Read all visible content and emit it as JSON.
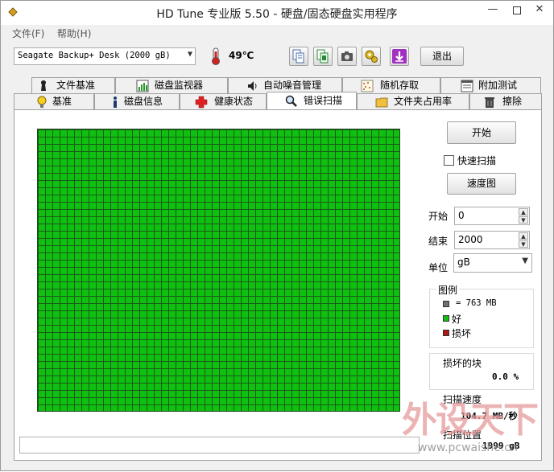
{
  "window": {
    "title": "HD Tune 专业版 5.50 - 硬盘/固态硬盘实用程序",
    "min": "—",
    "close": "✕"
  },
  "menu": {
    "file": "文件(F)",
    "help": "帮助(H)"
  },
  "toolbar": {
    "drive": "Seagate Backup+ Desk (2000 gB)",
    "temperature": "49℃",
    "exit": "退出",
    "icons": [
      "copy-text-icon",
      "copy-info-icon",
      "screenshot-camera-icon",
      "options-gear-icon",
      "save-download-icon"
    ]
  },
  "tabs": {
    "row1": [
      {
        "label": "文件基准",
        "icon": "file-benchmark-icon"
      },
      {
        "label": "磁盘监视器",
        "icon": "disk-monitor-icon"
      },
      {
        "label": "自动噪音管理",
        "icon": "speaker-icon"
      },
      {
        "label": "随机存取",
        "icon": "random-access-icon"
      },
      {
        "label": "附加测试",
        "icon": "extra-tests-icon"
      }
    ],
    "row2": [
      {
        "label": "基准",
        "icon": "benchmark-bulb-icon"
      },
      {
        "label": "磁盘信息",
        "icon": "info-icon"
      },
      {
        "label": "健康状态",
        "icon": "health-cross-icon"
      },
      {
        "label": "错误扫描",
        "icon": "magnifier-icon"
      },
      {
        "label": "文件夹占用率",
        "icon": "folder-icon"
      },
      {
        "label": "擦除",
        "icon": "trash-icon"
      }
    ],
    "active": "错误扫描"
  },
  "scan": {
    "start_button": "开始",
    "quick_scan": "快速扫描",
    "speed_map": "速度图",
    "start_label": "开始",
    "start_value": "0",
    "end_label": "结束",
    "end_value": "2000",
    "unit_label": "单位",
    "unit_value": "gB",
    "block_status": "good",
    "legend": {
      "title": "图例",
      "block_size": "= 763 MB",
      "good": "好",
      "bad": "损坏"
    },
    "colors": {
      "good": "#10c010",
      "bad": "#b01818",
      "block": "#707070",
      "grid": "#1a5a1a"
    },
    "stats": {
      "damaged_label": "损坏的块",
      "damaged_value": "0.0 %",
      "speed_label": "扫描速度",
      "speed_value": "104.7 MB/秒",
      "position_label": "扫描位置",
      "position_value": "1999 gB"
    },
    "status_text": ""
  },
  "watermark": {
    "text": "外设天下",
    "url": "www.pcwaishe.cn"
  }
}
